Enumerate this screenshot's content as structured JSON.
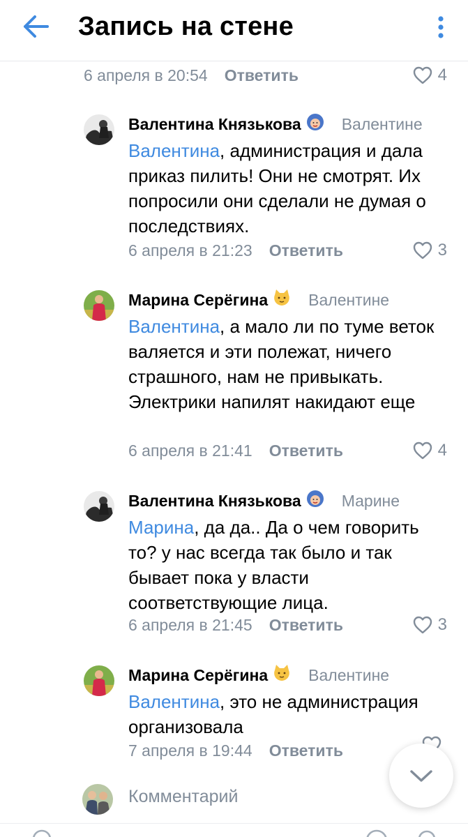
{
  "header": {
    "title": "Запись на стене",
    "back_icon": "arrow-left-icon",
    "menu_icon": "more-vertical-icon"
  },
  "colors": {
    "accent": "#3f8ae0",
    "secondary_text": "#818c99",
    "text": "#000000",
    "background": "#ffffff"
  },
  "top_meta": {
    "time": "6 апреля в 20:54",
    "reply": "Ответить",
    "likes": "4"
  },
  "comments": [
    {
      "author": "Валентина Князькова",
      "author_emoji": "🧕",
      "reply_to": "Валентине",
      "mention": "Валентина",
      "text": ", администрация и дала приказ пилить! Они не смотрят. Их попросили они сделали не думая о последствиях.",
      "time": "6 апреля в 21:23",
      "reply": "Ответить",
      "likes": "3"
    },
    {
      "author": "Марина Серёгина",
      "author_emoji": "🐱",
      "reply_to": "Валентине",
      "mention": "Валентина",
      "text": ", а мало ли по туме веток валяется и эти полежат, ничего страшного, нам не привыкать. Электрики напилят накидают еще",
      "time": "6 апреля в 21:41",
      "reply": "Ответить",
      "likes": "4"
    },
    {
      "author": "Валентина Князькова",
      "author_emoji": "🧕",
      "reply_to": "Марине",
      "mention": "Марина",
      "text": ",  да да.. Да о чем говорить то? у нас всегда так было и так бывает пока у власти соответствующие лица.",
      "time": "6 апреля в 21:45",
      "reply": "Ответить",
      "likes": "3"
    },
    {
      "author": "Марина Серёгина",
      "author_emoji": "🐱",
      "reply_to": "Валентине",
      "mention": "Валентина",
      "text": ", это не администрация организовала",
      "time": "7 апреля в 19:44",
      "reply": "Ответить",
      "likes": ""
    }
  ],
  "input": {
    "placeholder": "Комментарий"
  },
  "scroll_down_icon": "chevron-down-icon"
}
